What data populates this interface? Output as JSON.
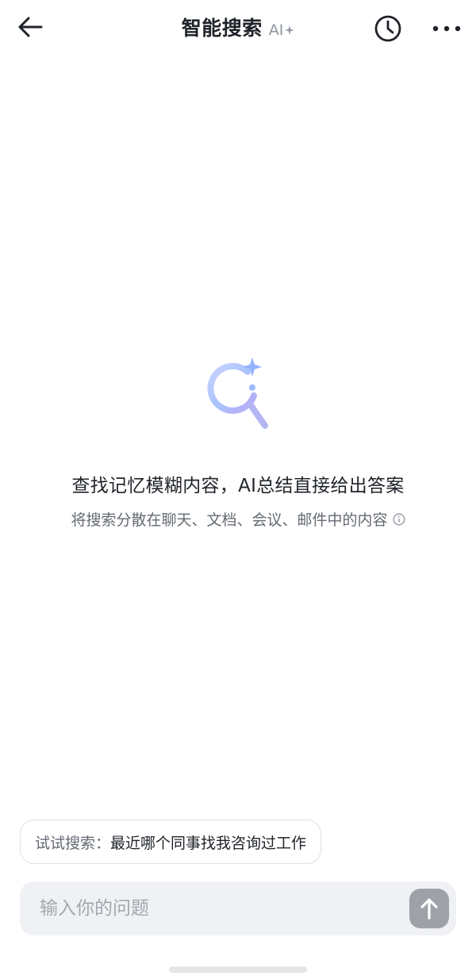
{
  "header": {
    "title": "智能搜索",
    "ai_badge": "AI"
  },
  "empty_state": {
    "headline": "查找记忆模糊内容，AI总结直接给出答案",
    "subline": "将搜索分散在聊天、文档、会议、邮件中的内容"
  },
  "suggestion": {
    "prefix": "试试搜索：",
    "query": "最近哪个同事找我咨询过工作"
  },
  "input": {
    "placeholder": "输入你的问题",
    "value": ""
  },
  "colors": {
    "accent_gradient_start": "#b9c6ff",
    "accent_gradient_end": "#9fb8ff",
    "sparkle": "#8fb0ff",
    "send_button": "#9ea2a8"
  },
  "icons": {
    "back": "arrow-left-icon",
    "history": "clock-icon",
    "more": "ellipsis-icon",
    "illustration": "ai-search-icon",
    "info": "info-icon",
    "send": "arrow-up-icon"
  }
}
